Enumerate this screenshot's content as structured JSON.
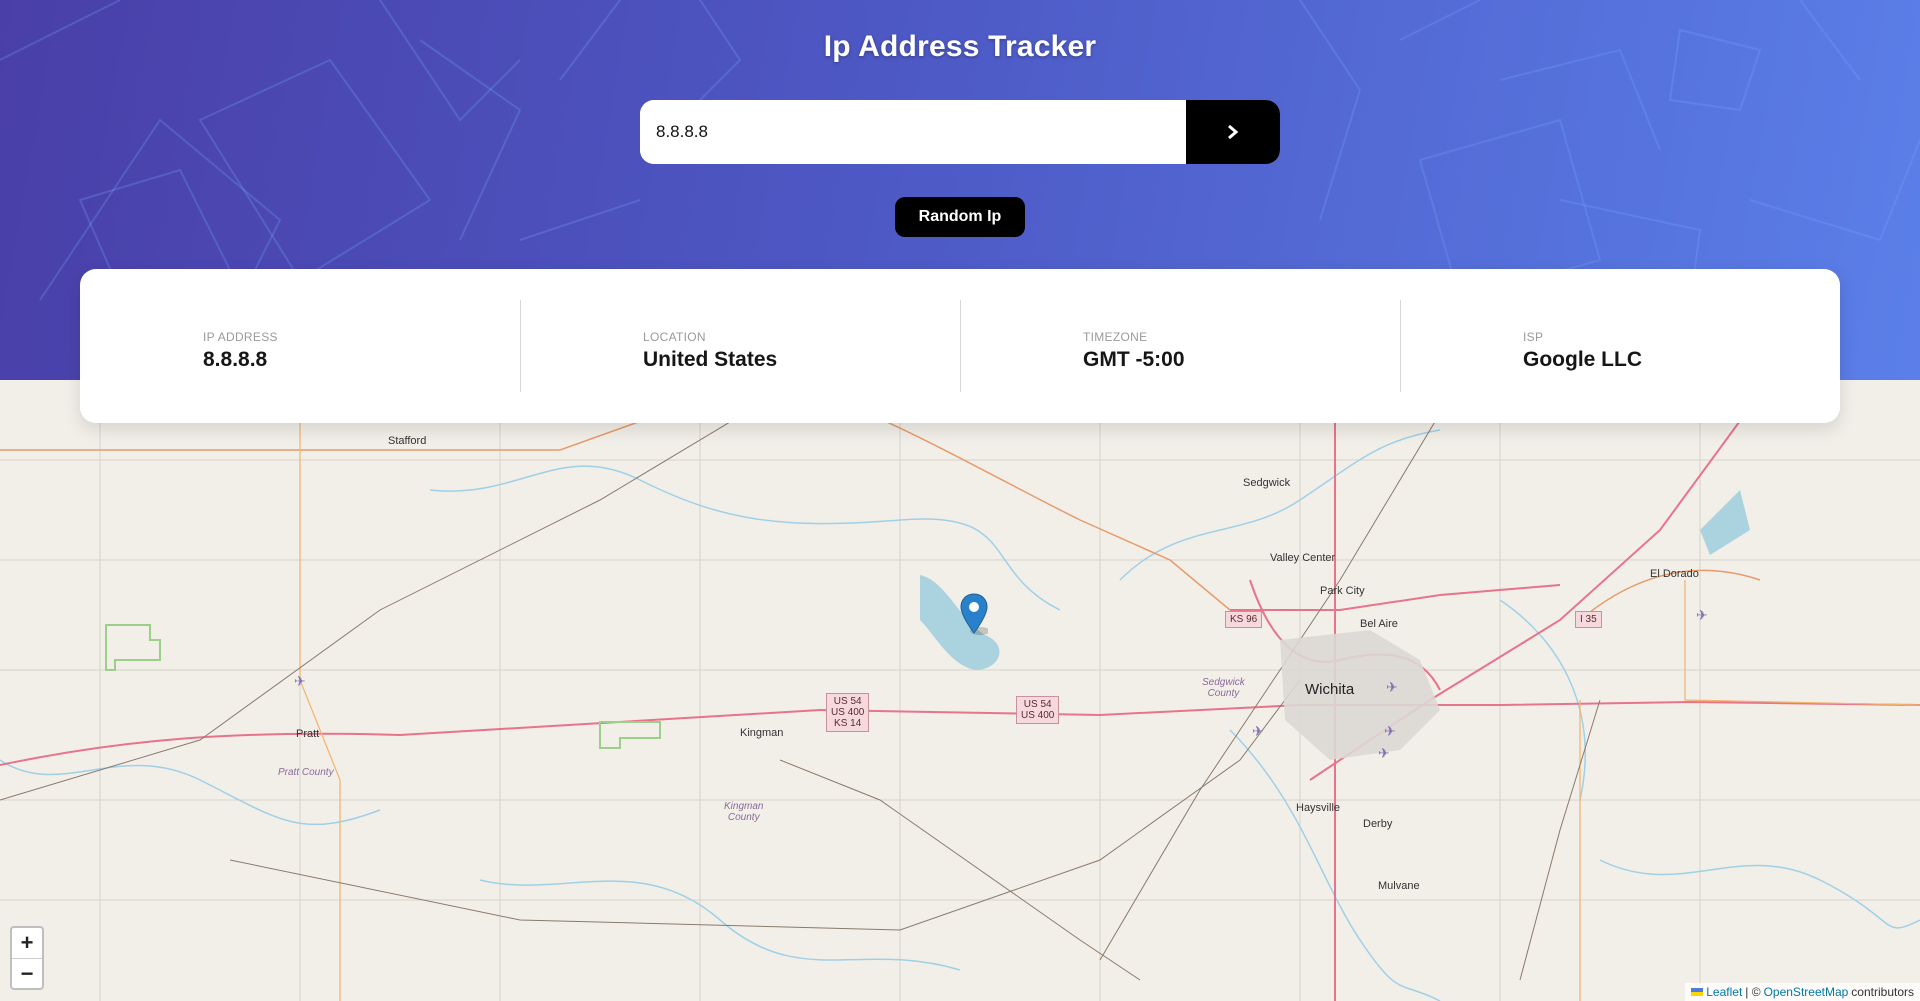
{
  "app": {
    "title": "Ip Address Tracker"
  },
  "search": {
    "value": "8.8.8.8",
    "submit_icon": "chevron-right-icon"
  },
  "random_button": {
    "label": "Random Ip"
  },
  "info": [
    {
      "label": "IP ADDRESS",
      "value": "8.8.8.8"
    },
    {
      "label": "LOCATION",
      "value": "United States"
    },
    {
      "label": "TIMEZONE",
      "value": "GMT -5:00"
    },
    {
      "label": "ISP",
      "value": "Google LLC"
    }
  ],
  "map": {
    "zoom_in": "+",
    "zoom_out": "−",
    "marker_icon": "map-pin-icon",
    "places": {
      "stafford": "Stafford",
      "sedgwick": "Sedgwick",
      "valley_center": "Valley Center",
      "park_city": "Park City",
      "bel_aire": "Bel Aire",
      "wichita": "Wichita",
      "el_dorado": "El Dorado",
      "pratt": "Pratt",
      "kingman": "Kingman",
      "haysville": "Haysville",
      "derby": "Derby",
      "mulvane": "Mulvane",
      "pratt_county": "Pratt County",
      "kingman_county_1": "Kingman",
      "kingman_county_2": "County",
      "sedgwick_county_1": "Sedgwick",
      "sedgwick_county_2": "County"
    },
    "shields": {
      "us54_a1": "US 54",
      "us54_a2": "US 400",
      "us54_a3": "KS 14",
      "us54_b1": "US 54",
      "us54_b2": "US 400",
      "ks96": "KS 96",
      "i35": "I 35"
    },
    "attribution": {
      "leaflet": "Leaflet",
      "separator": "| ©",
      "osm": "OpenStreetMap",
      "suffix": "contributors"
    }
  }
}
